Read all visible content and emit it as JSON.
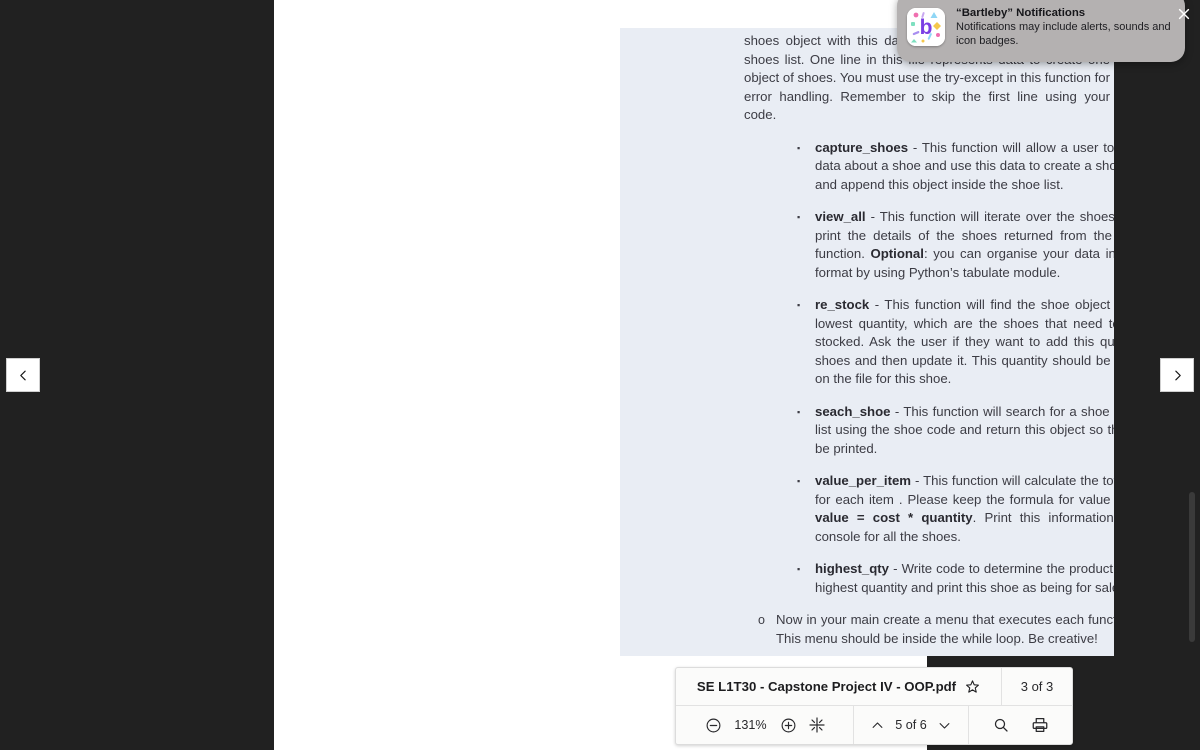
{
  "colors": {
    "backdrop": "#212121",
    "viewer_bg": "#ffffff",
    "page_bg": "#e9edf4",
    "toolbar_bg": "#fbfbfa",
    "notification_bg": "#b4b1b1",
    "text": "#3c3c44",
    "accent_purple": "#7b3fe4"
  },
  "notification": {
    "app_name": "“Bartleby” Notifications",
    "body": "Notifications may include alerts, sounds and icon badges.",
    "icon_letter": "b",
    "icon_name": "bartleby-app-icon"
  },
  "window": {
    "close_label": "✕"
  },
  "nav": {
    "prev_label": "‹",
    "next_label": "›"
  },
  "toolbar": {
    "file_name": "SE L1T30 - Capstone Project IV - OOP.pdf",
    "star_label": "☆",
    "file_count": "3 of 3",
    "zoom_out_label": "⊖",
    "zoom_level": "131%",
    "zoom_in_label": "⊕",
    "fit_label": "fit-page-icon",
    "page_prev_label": "∧",
    "page_indicator": "5 of 6",
    "page_next_label": "∨",
    "search_label": "search-icon",
    "print_label": "print-icon"
  },
  "document": {
    "intro_paragraph": "shoes object with this data  and append this object into the shoes list. One line in this file represents  data to create one object of shoes. You must use the try-except in this function for error handling. Remember to skip the first line using your code.",
    "bullets": [
      {
        "marker": "▪",
        "name": "capture_shoes",
        "rest": " - This function will allow a user to capture data about a shoe and use this data to create a shoe object and append this object inside the shoe list."
      },
      {
        "marker": "▪",
        "name": "view_all",
        "rest": " - This function will iterate over the shoes list and print the details of the shoes returned from the __str__ function. ",
        "bold_mid": "Optional",
        "rest2": ": you can organise your data in a table format by using Python’s tabulate module."
      },
      {
        "marker": "▪",
        "name": "re_stock",
        "rest": " - This function will find the shoe object with the lowest quantity, which are the shoes that need to be re-stocked. Ask the user if they want to add this quantity of shoes and then update it. This quantity should be updated on the file for this shoe."
      },
      {
        "marker": "▪",
        "name": "seach_shoe",
        "rest": " - This function will search for a shoe from the list using the shoe code and return this object so that it will be printed."
      },
      {
        "marker": "▪",
        "name": "value_per_item",
        "rest": " - This function will calculate the total value for each item . Please keep the formula for value in mind; ",
        "bold_mid": "value = cost * quantity",
        "rest2": ". Print this information on the console for all the shoes."
      },
      {
        "marker": "▪",
        "name": "highest_qty",
        "rest": " - Write code to determine the product with the highest quantity and print this shoe as being for sale."
      }
    ],
    "closing": {
      "marker": "o",
      "text": "Now in your main create a menu that executes each function above. This menu should be inside the while loop. Be creative!"
    }
  }
}
